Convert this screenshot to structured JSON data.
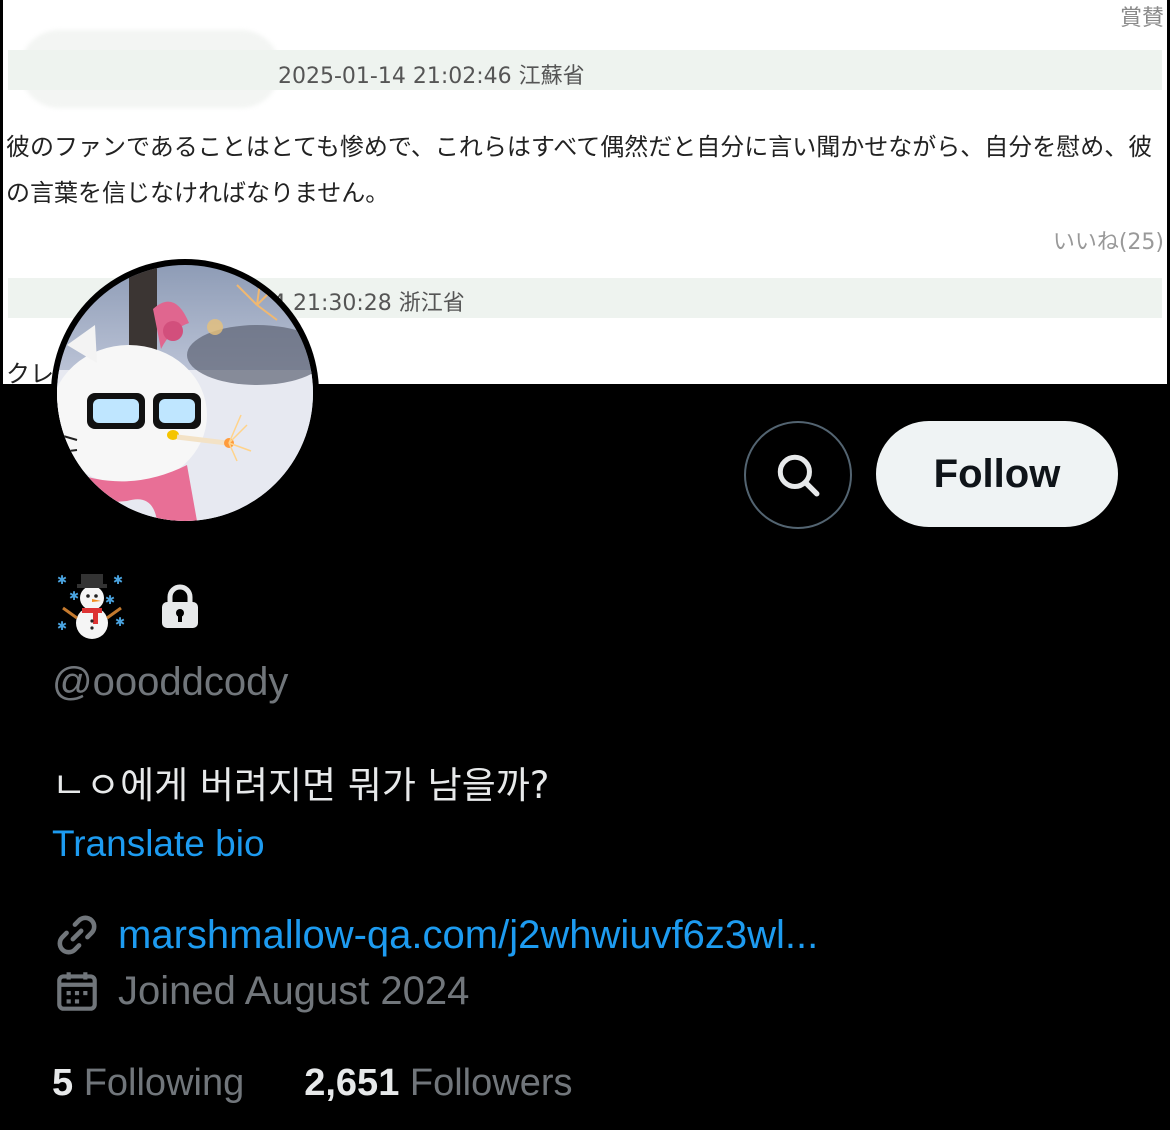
{
  "banner": {
    "corner_label": "賞賛",
    "comment1_meta": "2025-01-14 21:02:46 江蘇省",
    "comment1_text": "彼のファンであることはとても惨めで、これらはすべて偶然だと自分に言い聞かせながら、自分を慰め、彼の言葉を信じなければなりません。",
    "comment1_likes": "いいね(25)",
    "comment2_meta": "4 21:30:28 浙江省",
    "comment2_text": "クレ"
  },
  "profile": {
    "name_emoji": "☃️",
    "handle": "@oooddcody",
    "bio": "ㄴㅇ에게 버려지면 뭐가 남을까?",
    "translate_label": "Translate bio",
    "link": "marshmallow-qa.com/j2whwiuvf6z3wl...",
    "joined": "Joined August 2024"
  },
  "actions": {
    "follow_label": "Follow",
    "search_icon": "search-icon"
  },
  "stats": {
    "following_count": "5",
    "following_label": "Following",
    "followers_count": "2,651",
    "followers_label": "Followers"
  },
  "colors": {
    "accent": "#1d9bf0",
    "muted": "#71767b",
    "text": "#e7e9ea",
    "background": "#000000"
  }
}
